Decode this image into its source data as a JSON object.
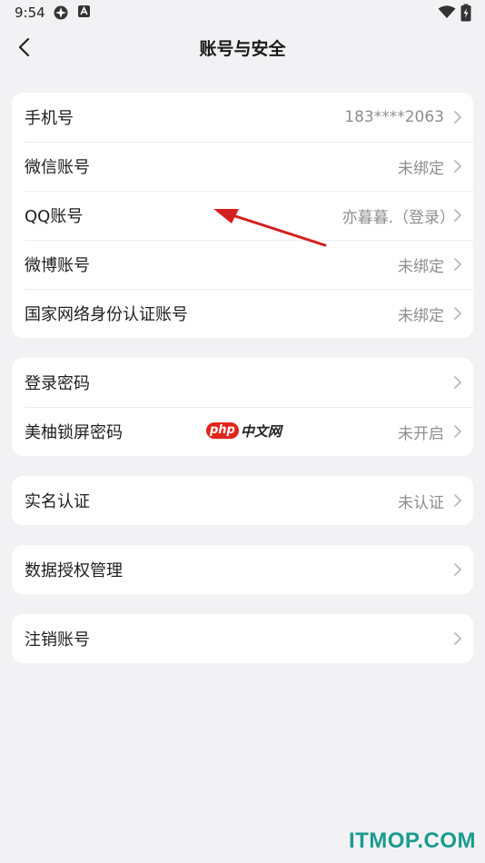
{
  "status_bar": {
    "time": "9:54"
  },
  "nav": {
    "title": "账号与安全"
  },
  "groups": [
    {
      "rows": [
        {
          "label": "手机号",
          "value": "183****2063"
        },
        {
          "label": "微信账号",
          "value": "未绑定"
        },
        {
          "label": "QQ账号",
          "value": "亦暮暮.（登录）"
        },
        {
          "label": "微博账号",
          "value": "未绑定"
        },
        {
          "label": "国家网络身份认证账号",
          "value": "未绑定"
        }
      ]
    },
    {
      "rows": [
        {
          "label": "登录密码",
          "value": ""
        },
        {
          "label": "美柚锁屏密码",
          "value": "未开启"
        }
      ]
    },
    {
      "rows": [
        {
          "label": "实名认证",
          "value": "未认证"
        }
      ]
    },
    {
      "rows": [
        {
          "label": "数据授权管理",
          "value": ""
        }
      ]
    },
    {
      "rows": [
        {
          "label": "注销账号",
          "value": ""
        }
      ]
    }
  ],
  "watermark": {
    "php": "php",
    "cn": "中文网"
  },
  "site_logo": "ITMOP.COM",
  "colors": {
    "background": "#f2f2f4",
    "card": "#ffffff",
    "value_text": "#8e8e8e",
    "annotation_arrow": "#d32020",
    "logo": "#1a9b8f"
  }
}
